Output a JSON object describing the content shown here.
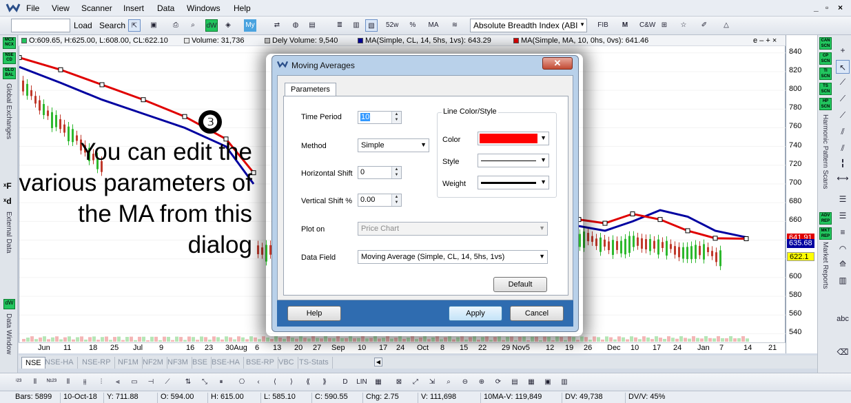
{
  "menubar": {
    "items": [
      "File",
      "View",
      "Scanner",
      "Insert",
      "Data",
      "Windows",
      "Help"
    ],
    "window_controls": [
      "_",
      "▫",
      "×"
    ]
  },
  "toolbar": {
    "load_label": "Load",
    "search_label": "Search",
    "indicator_select": "Absolute Breadth Index (ABI"
  },
  "left_rail": {
    "badges": [
      "MCX NCX",
      "NSE CD",
      "GLO BAL"
    ],
    "global_exchanges": "Global Exchanges",
    "external_data": "External Data",
    "data_window": "Data Window"
  },
  "right_rail": {
    "scans": [
      "CAN SCN",
      "CP SCN",
      "TI SCN",
      "TS SCN",
      "HP SCN"
    ],
    "harmonic": "Harmonic Pattern Scans",
    "reports": [
      "ADV REP",
      "MKT REP"
    ],
    "market_reports": "Market Reports",
    "abc": "abc"
  },
  "chart": {
    "ohlc": "O:609.65, H:625.00, L:608.00, CL:622.10",
    "volume": "Volume: 31,736",
    "dely_volume": "Dely Volume: 9,540",
    "ma1": "MA(Simple, CL, 14, 5hs, 1vs): 643.29",
    "ma2": "MA(Simple, MA, 10, 0hs, 0vs): 641.46",
    "corner_controls": "e – + ×",
    "colors": {
      "ma1": "#0000a0",
      "ma2": "#e00000",
      "up": "#2db82d",
      "down": "#c0392b"
    }
  },
  "chart_data": {
    "type": "line",
    "title": "",
    "ylim": [
      530,
      845
    ],
    "y_ticks": [
      "840",
      "820",
      "800",
      "780",
      "760",
      "740",
      "720",
      "700",
      "680",
      "660",
      "640",
      "620",
      "600",
      "580",
      "560",
      "540"
    ],
    "x_ticks": [
      "Jun",
      "11",
      "18",
      "25",
      "Jul",
      "9",
      "16",
      "23",
      "30Aug",
      "6",
      "13",
      "20",
      "27",
      "Sep",
      "10",
      "17",
      "24",
      "Oct",
      "8",
      "15",
      "22",
      "29 Nov5",
      "12",
      "19",
      "26",
      "Dec",
      "10",
      "17",
      "24",
      "Jan",
      "7",
      "14",
      "21"
    ],
    "price_badges": {
      "ma2": "641.91",
      "ma1": "635.68",
      "last": "622.1"
    },
    "series": [
      {
        "name": "MA(Simple, CL, 14, 5hs, 1vs)",
        "color": "#0000a0",
        "values": [
          825,
          808,
          790,
          775,
          760,
          740,
          700,
          668,
          655,
          650,
          660,
          672,
          665,
          650,
          643
        ]
      },
      {
        "name": "MA(Simple, MA, 10, 0hs, 0vs)",
        "color": "#e00000",
        "values": [
          835,
          822,
          806,
          790,
          772,
          748,
          712,
          678,
          662,
          658,
          668,
          662,
          650,
          642,
          641.5
        ]
      }
    ]
  },
  "annotation": {
    "step": "❸",
    "text": "You can edit the various parameters of the MA from this dialog"
  },
  "tabs": [
    "NSE",
    "NSE-HA",
    "NSE-RP",
    "NF1M",
    "NF2M",
    "NF3M",
    "BSE",
    "BSE-HA",
    "BSE-RP",
    "VBC",
    "TS-Stats"
  ],
  "status": {
    "bars": "Bars: 5899",
    "date": "10-Oct-18",
    "y": "Y: 711.88",
    "o": "O: 594.00",
    "h": "H: 615.00",
    "l": "L: 585.10",
    "c": "C: 590.55",
    "chg": "Chg: 2.75",
    "v": "V: 111,698",
    "mav": "10MA-V: 119,849",
    "dv": "DV: 49,738",
    "dvv": "DV/V: 45%"
  },
  "dialog": {
    "title": "Moving Averages",
    "tab": "Parameters",
    "time_period_label": "Time Period",
    "time_period_value": "10",
    "method_label": "Method",
    "method_value": "Simple",
    "hshift_label": "Horizontal Shift",
    "hshift_value": "0",
    "vshift_label": "Vertical Shift %",
    "vshift_value": "0.00",
    "plot_on_label": "Plot on",
    "plot_on_value": "Price Chart",
    "data_field_label": "Data Field",
    "data_field_value": "Moving Average (Simple, CL, 14, 5hs, 1vs)",
    "group_title": "Line Color/Style",
    "color_label": "Color",
    "style_label": "Style",
    "weight_label": "Weight",
    "line_color": "#ff0000",
    "default_label": "Default",
    "help_label": "Help",
    "apply_label": "Apply",
    "cancel_label": "Cancel"
  }
}
